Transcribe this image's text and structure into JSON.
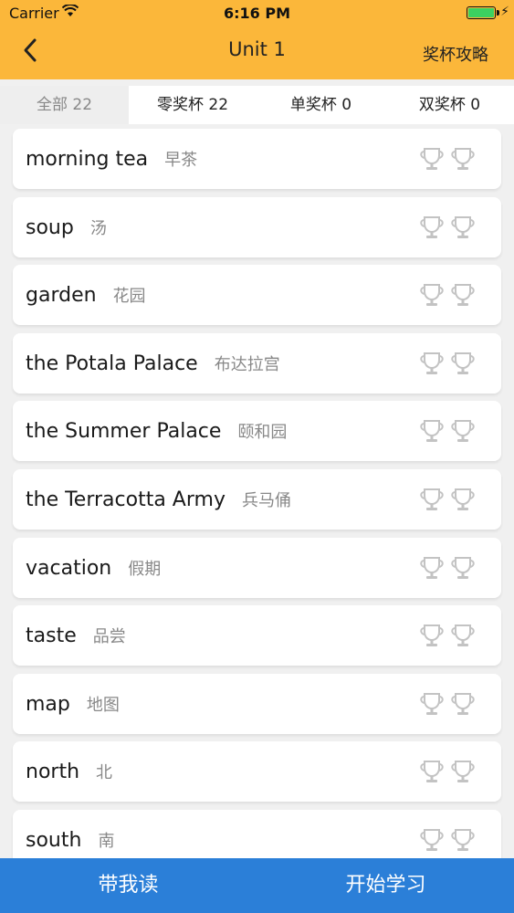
{
  "status_bar": {
    "carrier": "Carrier",
    "time": "6:16 PM",
    "wifi_icon": "wifi-icon",
    "battery_icon": "battery-charging-icon"
  },
  "nav": {
    "back_icon": "chevron-left-icon",
    "title": "Unit 1",
    "strategy_label": "奖杯攻略"
  },
  "tabs": [
    {
      "label": "全部 22",
      "active": true
    },
    {
      "label": "零奖杯 22",
      "active": false
    },
    {
      "label": "单奖杯 0",
      "active": false
    },
    {
      "label": "双奖杯 0",
      "active": false
    }
  ],
  "words": [
    {
      "en": "morning tea",
      "cn": "早茶"
    },
    {
      "en": "soup",
      "cn": "汤"
    },
    {
      "en": "garden",
      "cn": "花园"
    },
    {
      "en": "the Potala Palace",
      "cn": "布达拉宫"
    },
    {
      "en": "the Summer Palace",
      "cn": "颐和园"
    },
    {
      "en": "the Terracotta Army",
      "cn": "兵马俑"
    },
    {
      "en": "vacation",
      "cn": "假期"
    },
    {
      "en": "taste",
      "cn": "品尝"
    },
    {
      "en": "map",
      "cn": "地图"
    },
    {
      "en": "north",
      "cn": "北"
    },
    {
      "en": "south",
      "cn": "南"
    }
  ],
  "bottom": {
    "read_with_me": "带我读",
    "start_learning": "开始学习"
  },
  "colors": {
    "header": "#fbb73a",
    "bottom_bar": "#2b7fd8",
    "trophy_inactive": "#c8c8c8"
  }
}
